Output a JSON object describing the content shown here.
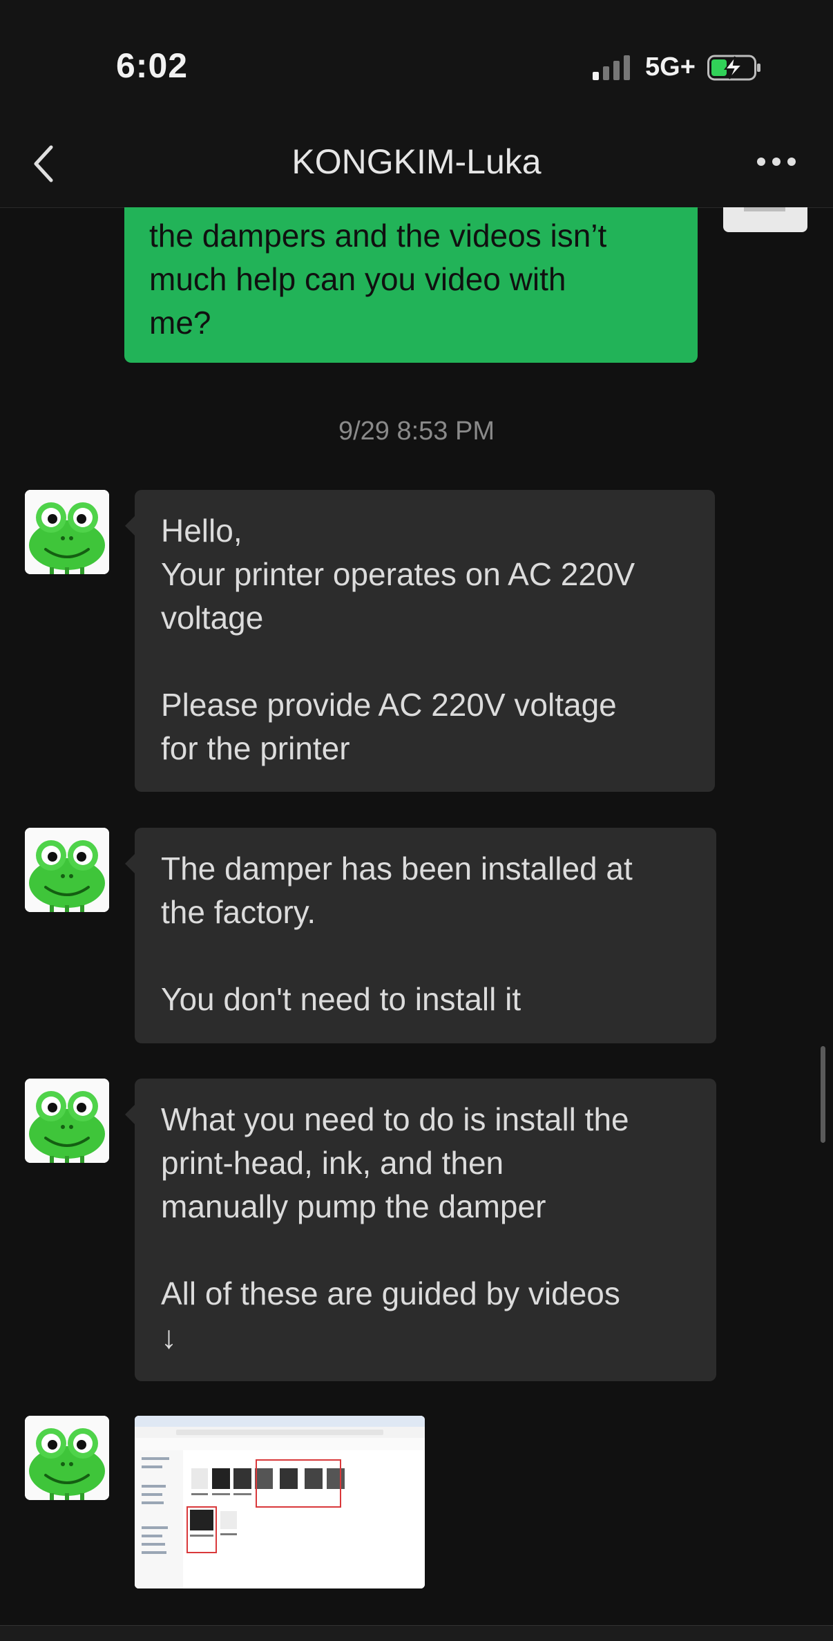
{
  "status": {
    "time": "6:02",
    "network": "5G+"
  },
  "header": {
    "title": "KONGKIM-Luka"
  },
  "messages": {
    "outgoing_partial": "the dampers and the videos isn’t\nmuch help can you video with\nme?",
    "timestamp": "9/29 8:53 PM",
    "incoming": [
      "Hello,\nYour printer operates on AC 220V\nvoltage\n\nPlease provide AC 220V voltage\nfor the printer",
      "The damper has been installed at\nthe factory.\n\nYou don't need to install it",
      "What you need to do is install the\nprint-head, ink, and then\nmanually pump the damper\n\nAll of these are guided by videos\n↓"
    ]
  },
  "colors": {
    "outgoing_bubble": "#22b358",
    "incoming_bubble": "#2c2c2c",
    "background": "#111111"
  },
  "icons": [
    "signal-icon",
    "battery-charging-icon",
    "back-chevron-icon",
    "more-icon",
    "frog-avatar-icon"
  ]
}
